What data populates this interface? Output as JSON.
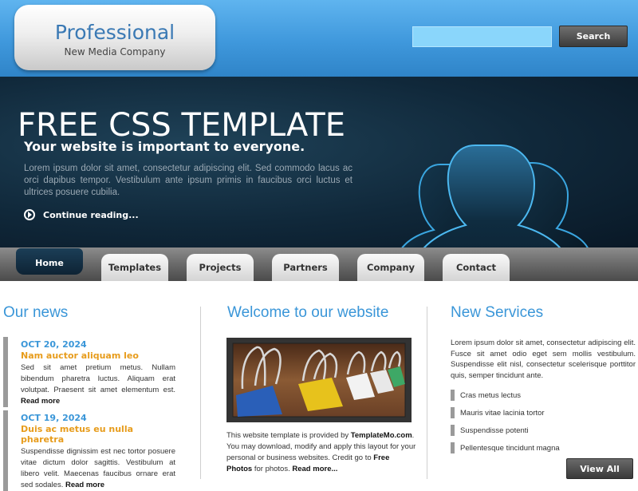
{
  "header": {
    "logo_title": "Professional",
    "logo_subtitle": "New Media Company",
    "search_value": "",
    "search_button": "Search"
  },
  "banner": {
    "title": "FREE CSS TEMPLATE",
    "subtitle": "Your website is important to everyone.",
    "text": "Lorem ipsum dolor sit amet, consectetur adipiscing elit. Sed commodo lacus ac orci dapibus tempor. Vestibulum ante ipsum primis in faucibus orci luctus et ultrices posuere cubilia.",
    "continue_label": "Continue reading..."
  },
  "nav": {
    "items": [
      "Home",
      "Templates",
      "Projects",
      "Partners",
      "Company",
      "Contact"
    ],
    "active": "Home"
  },
  "news": {
    "title": "Our news",
    "items": [
      {
        "date": "OCT 20, 2024",
        "headline": "Nam auctor aliquam leo",
        "text": "Sed sit amet pretium metus. Nullam bibendum pharetra luctus. Aliquam erat volutpat. Praesent sit amet elementum est.",
        "read_more": "Read more"
      },
      {
        "date": "OCT 19, 2024",
        "headline": "Duis ac metus eu nulla pharetra",
        "text": "Suspendisse dignissim est nec tortor posuere vitae dictum dolor sagittis. Vestibulum at libero velit. Maecenas faucibus ornare erat sed sodales.",
        "read_more": "Read more"
      }
    ]
  },
  "welcome": {
    "title": "Welcome to our website",
    "text_1": "This website template is provided by ",
    "brand": "TemplateMo.com",
    "text_2": ". You may download, modify and apply this layout for your personal or business websites. Credit go to ",
    "photo_credit": "Free Photos",
    "text_3": " for photos. ",
    "read_more": "Read more..."
  },
  "services": {
    "title": "New Services",
    "text": "Lorem ipsum dolor sit amet, consectetur adipiscing elit. Fusce sit amet odio eget sem mollis vestibulum. Suspendisse elit nisl, consectetur scelerisque porttitor quis, semper tincidunt ante.",
    "items": [
      "Cras metus lectus",
      "Mauris vitae lacinia tortor",
      "Suspendisse potenti",
      "Pellentesque tincidunt magna"
    ],
    "view_all": "View All"
  },
  "colors": {
    "header_blue": "#3f98dc",
    "accent_blue": "#3a96d8",
    "accent_orange": "#e79c1c",
    "banner_dark": "#10283a"
  },
  "icons": [
    "continue-arrow-icon",
    "people-silhouette-icon",
    "binder-clips-image"
  ]
}
